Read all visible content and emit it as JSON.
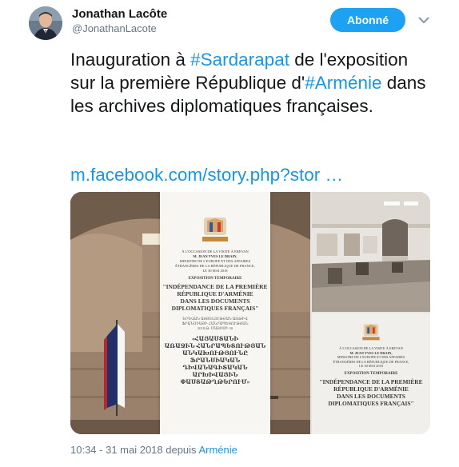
{
  "author": {
    "name": "Jonathan Lacôte",
    "handle": "@JonathanLacote"
  },
  "follow_button": {
    "label": "Abonné"
  },
  "icons": {
    "more": "chevron-down-icon",
    "avatar": "profile-photo"
  },
  "tweet": {
    "part1": "Inauguration à ",
    "hashtag1": "#Sardarapat",
    "part2": " de l'exposition sur la première République d'",
    "hashtag2": "#Arménie",
    "part3": " dans les archives diplomatiques françaises.",
    "link": "m.facebook.com/story.php?stor …"
  },
  "media": {
    "banner": {
      "line1": "À L'OCCASION DE LA VISITE À EREVAN",
      "line2": "M. JEAN YVES LE DRAIN,",
      "line3": "MINISTRE DE L'EUROPE ET DES AFFAIRES",
      "line4": "ÉTRANGÈRES DE LA RÉPUBLIQUE DE FRANCE,",
      "line5": "LE 30 MAI 2018",
      "line6": "EXPOSITION TEMPORAIRE",
      "line7": "\"INDÉPENDANCE DE LA PREMIÈRE",
      "line8": "RÉPUBLIQUE D'ARMÉNIE",
      "line9": "DANS LES DOCUMENTS",
      "line10": "DIPLOMATIQUES FRANÇAIS\"",
      "arm1": "«ՀԱՅԱՍՏԱՆԻ",
      "arm2": "ԱՌԱՋԻՆ ՀԱՆՐԱՊԵՏՈՒԹՅԱՆ",
      "arm3": "ԱՆԿԱԽՈՒԹՅՈՒՆԸ",
      "arm4": "ՖՐԱՆՍԻԱԿԱՆ ԴԻՎԱՆԱԳԻՏԱԿԱՆ",
      "arm5": "ԱՐԽԻՎԱՅԻՆ ՓԱՍՏԱԹՂԹԵՐՈՒՄ»"
    },
    "banner_small": {
      "line1": "À L'OCCASION DE LA VISITE À EREVAN",
      "line2": "M. JEAN YVES LE DRAIN,",
      "line3": "MINISTRE DE L'EUROPE ET DES AFFAIRES",
      "line4": "ÉTRANGÈRES DE LA RÉPUBLIQUE DE FRANCE,",
      "line5": "LE 30 MAI 2018",
      "line6": "EXPOSITION TEMPORAIRE",
      "line7": "\"INDÉPENDANCE DE LA PREMIÈRE",
      "line8": "RÉPUBLIQUE D'ARMÉNIE",
      "line9": "DANS LES DOCUMENTS",
      "line10": "DIPLOMATIQUES FRANÇAIS\""
    }
  },
  "footer": {
    "timestamp": "10:34 - 31 mai 2018 depuis ",
    "place": "Arménie"
  },
  "colors": {
    "accent": "#1da1f2",
    "link": "#1b95e0",
    "muted": "#657786"
  }
}
